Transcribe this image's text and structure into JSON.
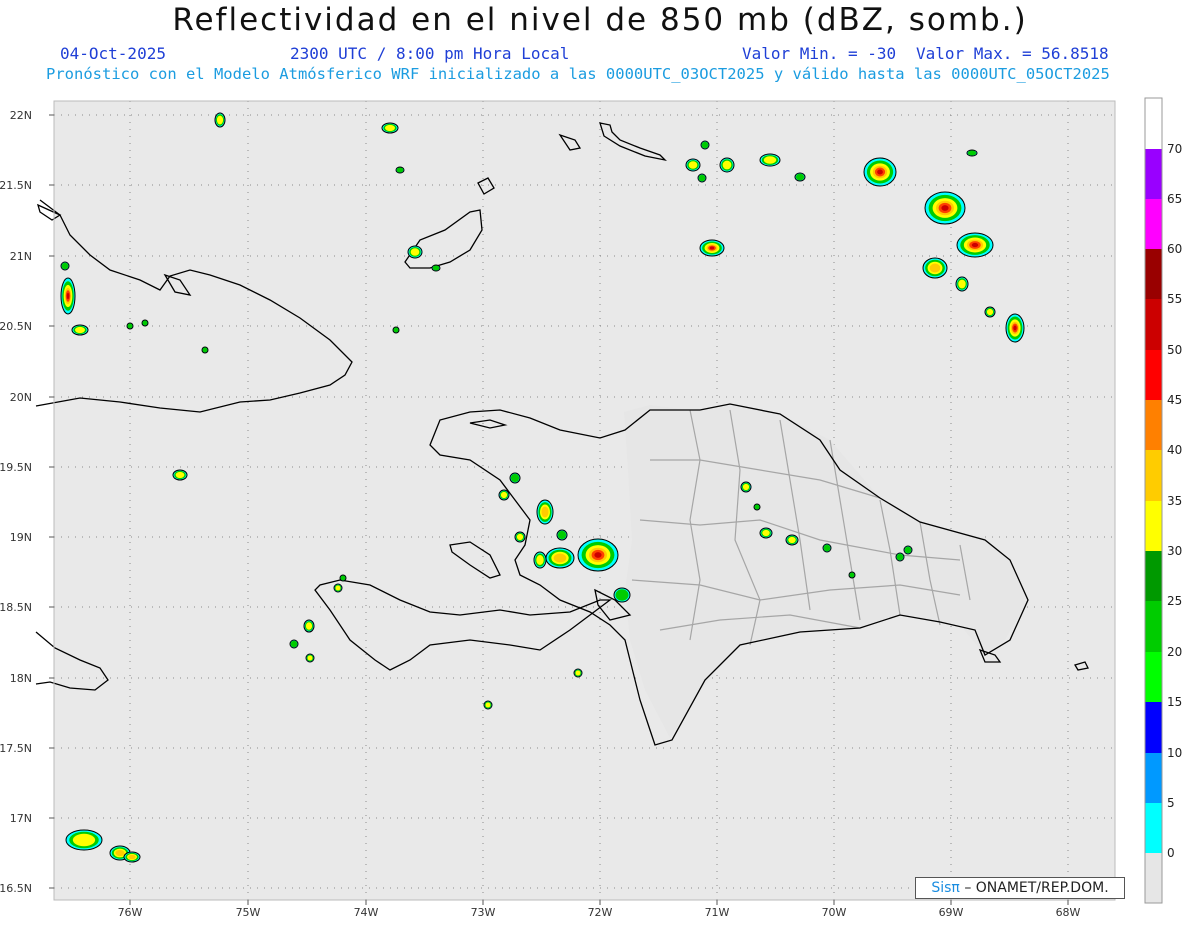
{
  "header": {
    "title": "Reflectividad en el nivel de 850 mb (dBZ, somb.)",
    "date": "04-Oct-2025",
    "time": "2300 UTC / 8:00 pm Hora Local",
    "min_label": "Valor Min. = -30",
    "max_label": "Valor Max. = 56.8518",
    "model_line": "Pronóstico con el Modelo Atmósferico WRF inicializado a las 0000UTC_03OCT2025 y válido hasta las 0000UTC_05OCT2025"
  },
  "map": {
    "lon_range": [
      -76.65,
      -67.6
    ],
    "lat_range": [
      16.4,
      22.1
    ],
    "lon_ticks": [
      "76W",
      "75W",
      "74W",
      "73W",
      "72W",
      "71W",
      "70W",
      "69W",
      "68W"
    ],
    "lat_ticks": [
      "22N",
      "21.5N",
      "21N",
      "20.5N",
      "20N",
      "19.5N",
      "19N",
      "18.5N",
      "18N",
      "17.5N",
      "17N",
      "16.5N"
    ],
    "background": "#e9e9e9",
    "coast_color": "#000000",
    "province_color": "#a6a6a6"
  },
  "colorbar": {
    "labels": [
      "0",
      "5",
      "10",
      "15",
      "20",
      "25",
      "30",
      "35",
      "40",
      "45",
      "50",
      "55",
      "60",
      "65",
      "70"
    ],
    "colors": [
      "#e6e6e6",
      "#00ffff",
      "#0099ff",
      "#0000ff",
      "#00ff00",
      "#00cc00",
      "#009900",
      "#ffff00",
      "#ffcc00",
      "#ff8000",
      "#ff0000",
      "#cc0000",
      "#990000",
      "#ff00ff",
      "#9900ff",
      "#ffffff"
    ]
  },
  "credit": {
    "logo": "Sisπ",
    "text": "– ONAMET/REP.DOM."
  }
}
